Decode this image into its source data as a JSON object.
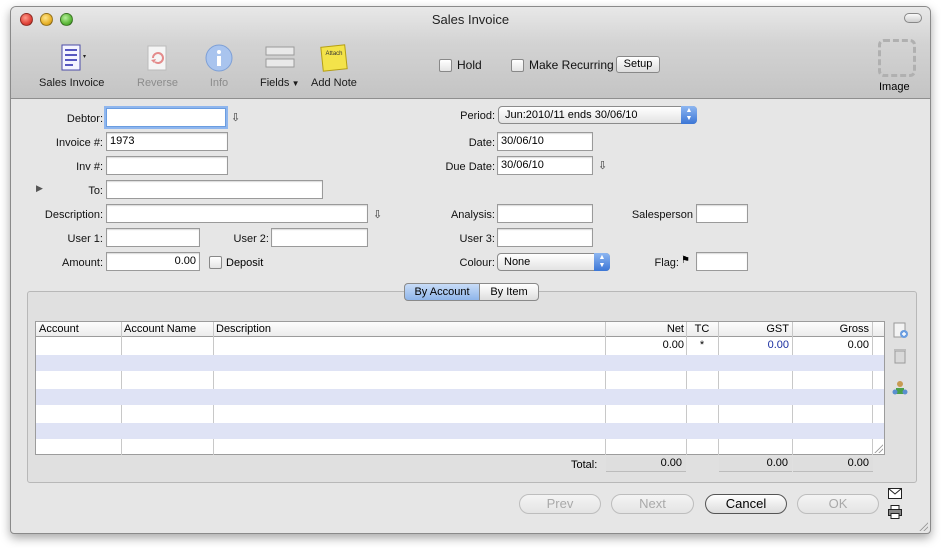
{
  "window": {
    "title": "Sales Invoice"
  },
  "toolbar": {
    "sales_invoice": "Sales Invoice",
    "reverse": "Reverse",
    "info": "Info",
    "fields": "Fields",
    "add_note": "Add Note",
    "note_sticker": "Attach",
    "hold": "Hold",
    "make_recurring": "Make Recurring",
    "setup": "Setup",
    "image": "Image"
  },
  "form": {
    "debtor_label": "Debtor:",
    "debtor_value": "",
    "invoice_label": "Invoice #:",
    "invoice_value": "1973",
    "inv_label": "Inv #:",
    "inv_value": "",
    "to_label": "To:",
    "to_value": "",
    "description_label": "Description:",
    "description_value": "",
    "user1_label": "User 1:",
    "user1_value": "",
    "user2_label": "User 2:",
    "user2_value": "",
    "amount_label": "Amount:",
    "amount_value": "0.00",
    "deposit_label": "Deposit",
    "period_label": "Period:",
    "period_value": "Jun:2010/11 ends 30/06/10",
    "date_label": "Date:",
    "date_value": "30/06/10",
    "due_date_label": "Due Date:",
    "due_date_value": "30/06/10",
    "analysis_label": "Analysis:",
    "analysis_value": "",
    "salesperson_label": "Salesperson",
    "salesperson_value": "",
    "user3_label": "User 3:",
    "user3_value": "",
    "colour_label": "Colour:",
    "colour_value": "None",
    "flag_label": "Flag:",
    "flag_value": ""
  },
  "tabs": {
    "by_account": "By Account",
    "by_item": "By Item",
    "selected": "By Account"
  },
  "grid": {
    "columns": [
      "Account",
      "Account Name",
      "Description",
      "Net",
      "TC",
      "GST",
      "Gross"
    ],
    "rows": [
      {
        "account": "",
        "account_name": "",
        "description": "",
        "net": "0.00",
        "tc": "*",
        "gst": "0.00",
        "gross": "0.00"
      }
    ],
    "total_label": "Total:",
    "total_net": "0.00",
    "total_gst": "0.00",
    "total_gross": "0.00"
  },
  "buttons": {
    "prev": "Prev",
    "next": "Next",
    "cancel": "Cancel",
    "ok": "OK"
  },
  "colors": {
    "accent": "#3c76d6",
    "row_alt": "#dfe3f5",
    "gst_text": "#1a2ea0"
  }
}
